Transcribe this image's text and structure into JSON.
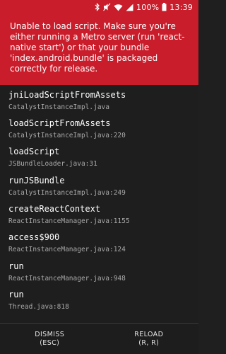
{
  "status_bar": {
    "battery_text": "100%",
    "time": "13:39",
    "icons": [
      "bluetooth-icon",
      "mute-icon",
      "wifi-icon",
      "signal-icon",
      "battery-icon"
    ]
  },
  "error": {
    "message": "Unable to load script. Make sure you're either running a Metro server (run 'react-native start') or that your bundle 'index.android.bundle' is packaged correctly for release.",
    "background_color": "#c91d2b"
  },
  "stack_frames": [
    {
      "method": "jniLoadScriptFromAssets",
      "location": "CatalystInstanceImpl.java"
    },
    {
      "method": "loadScriptFromAssets",
      "location": "CatalystInstanceImpl.java:220"
    },
    {
      "method": "loadScript",
      "location": "JSBundleLoader.java:31"
    },
    {
      "method": "runJSBundle",
      "location": "CatalystInstanceImpl.java:249"
    },
    {
      "method": "createReactContext",
      "location": "ReactInstanceManager.java:1155"
    },
    {
      "method": "access$900",
      "location": "ReactInstanceManager.java:124"
    },
    {
      "method": "run",
      "location": "ReactInstanceManager.java:948"
    },
    {
      "method": "run",
      "location": "Thread.java:818"
    }
  ],
  "footer": {
    "dismiss_label": "DISMISS",
    "dismiss_shortcut": "(ESC)",
    "reload_label": "RELOAD",
    "reload_shortcut": "(R, R)"
  }
}
